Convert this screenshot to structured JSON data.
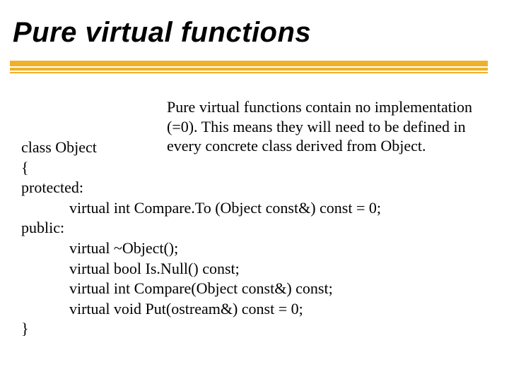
{
  "title": "Pure virtual functions",
  "annotation": "Pure virtual functions contain no implementation (=0).  This means they will need to be defined in every concrete class derived from Object.",
  "code": {
    "l1": "class Object",
    "l2": "{",
    "l3": "protected:",
    "l4": "virtual int Compare.To (Object const&) const = 0;",
    "l5": "public:",
    "l6": "virtual ~Object();",
    "l7": "virtual bool Is.Null() const;",
    "l8": "virtual int Compare(Object const&) const;",
    "l9": "virtual void Put(ostream&) const = 0;",
    "l10": "}"
  }
}
